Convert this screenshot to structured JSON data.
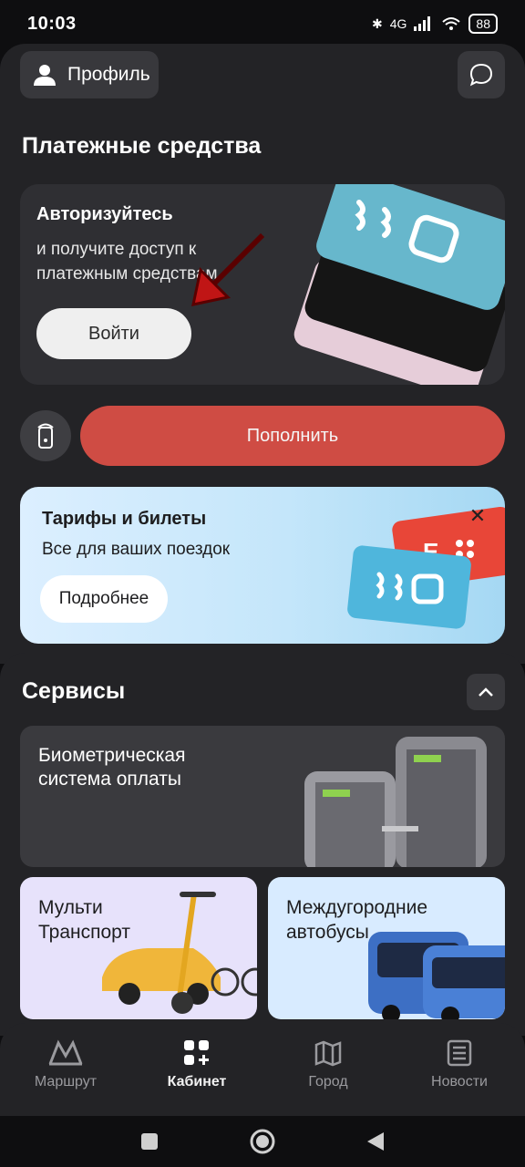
{
  "status": {
    "time": "10:03",
    "battery": "88",
    "network": "4G"
  },
  "header": {
    "profile_label": "Профиль"
  },
  "payments": {
    "title": "Платежные средства",
    "auth_title": "Авторизуйтесь",
    "auth_subtitle": "и получите доступ к платежным средствам",
    "login_label": "Войти",
    "topup_label": "Пополнить"
  },
  "tariffs": {
    "title": "Тарифы и билеты",
    "subtitle": "Все для ваших поездок",
    "more_label": "Подробнее",
    "close_icon": "✕"
  },
  "services": {
    "title": "Сервисы",
    "biometric": "Биометрическая система оплаты",
    "multi_line1": "Мульти",
    "multi_line2": "Транспорт",
    "bus_line1": "Междугородние",
    "bus_line2": "автобусы"
  },
  "nav": [
    {
      "label": "Маршрут",
      "icon": "metro-icon"
    },
    {
      "label": "Кабинет",
      "icon": "grid-plus-icon"
    },
    {
      "label": "Город",
      "icon": "map-icon"
    },
    {
      "label": "Новости",
      "icon": "news-icon"
    }
  ],
  "colors": {
    "accent": "#cf4c44",
    "background": "#0e0e10",
    "card": "#2f2f33"
  }
}
